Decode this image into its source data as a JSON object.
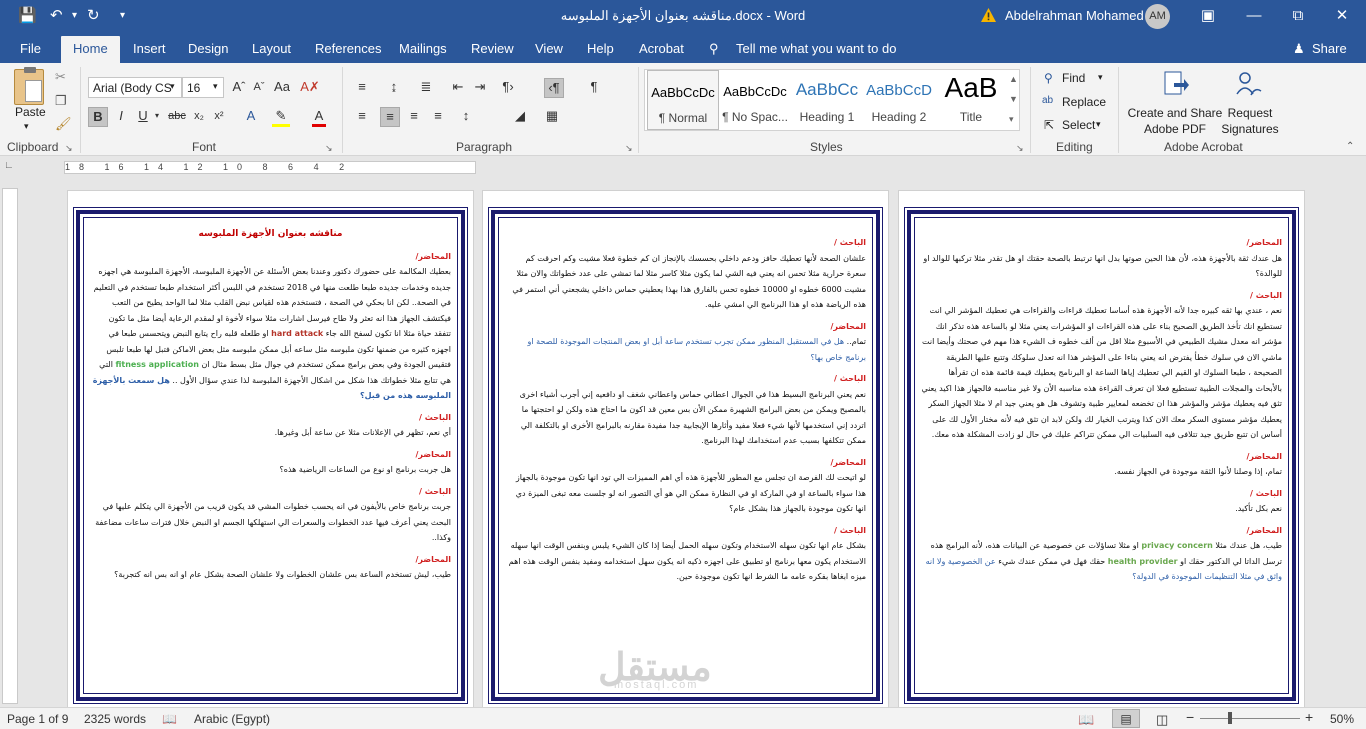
{
  "titlebar": {
    "doc_title": "مناقشه بعنوان الأجهزة الملبوسه.docx",
    "app_suffix": " - Word",
    "user_name": "Abdelrahman Mohamed",
    "user_initials": "AM"
  },
  "tabs": [
    "File",
    "Home",
    "Insert",
    "Design",
    "Layout",
    "References",
    "Mailings",
    "Review",
    "View",
    "Help",
    "Acrobat"
  ],
  "tell_me": "Tell me what you want to do",
  "share": "Share",
  "clipboard": {
    "paste": "Paste",
    "group": "Clipboard"
  },
  "font": {
    "name": "Arial (Body CS",
    "size": "16",
    "group": "Font"
  },
  "paragraph": {
    "group": "Paragraph"
  },
  "styles": {
    "group": "Styles",
    "items": [
      {
        "preview": "AaBbCcDc",
        "name": "¶ Normal"
      },
      {
        "preview": "AaBbCcDc",
        "name": "¶ No Spac..."
      },
      {
        "preview": "AaBbCc",
        "name": "Heading 1"
      },
      {
        "preview": "AaBbCcD",
        "name": "Heading 2"
      },
      {
        "preview": "AaB",
        "name": "Title"
      }
    ]
  },
  "editing": {
    "find": "Find",
    "replace": "Replace",
    "select": "Select",
    "group": "Editing"
  },
  "acrobat": {
    "create": "Create and Share Adobe PDF",
    "request": "Request Signatures",
    "group": "Adobe Acrobat"
  },
  "ruler": {
    "ticks": "18 16 14 12 10 8 6 4 2"
  },
  "pages": {
    "p1": {
      "title": "مناقشه بعنوان الأجهزة الملبوسه",
      "s1": "المحاضر/",
      "t1": "بعطيك المكالمة على حضورك دكتور وعندنا بعض الأسئلة عن الأجهزة الملبوسة، الأجهزة الملبوسة هي اجهزه جديده وخدمات جديده طبعا طلعت منها في 2018 تستخدم في اللبس أكثر استخدام طبعا تستخدم في التعليم في الصحة.. لكن انا بحكي في الصحة ، فتستخدم هذه لقياس نبض القلب مثلا لما الواحد يطيح من التعب فيكتشف الجهاز هذا انه تعثر ولا طاح فيرسل اشارات مثلا سواء لأخوة او لمقدم الرعاية أيضا مثل ما تكون تتفقد حياة مثلا انا تكون لسفح الله جاء",
      "hard_attack": "hard attack",
      "t1b": "او طلعله قلبه راح يتابع النبض ويتحسس طبعا في اجهزه كثيره من ضمنها تكون ملبوسه مثل ساعه أبل ممكن ملبوسه مثل بعض الاماكن فتبل لها طبعا تلبس فتقيس الجودة وفي بعض برامج ممكن تستخدم في جوال مثل بسط مثال ان",
      "fitness": "fitness application",
      "t1c": "التي هي تتابع مثلا خطواتك هذا شكل من اشكال الأجهزة الملبوسة لذا عندي سؤال الأول ..",
      "q1": "هل سمعت بالأجهزة الملبوسه هذه من قبل؟",
      "s2": "الباحث /",
      "t2": "أي نعم، تظهر في الإعلانات مثلا عن ساعة أبل وغيرها.",
      "s3": "المحاضر/",
      "t3": "هل جربت برنامج او نوع من الساعات الرياضية هذه؟",
      "s4": "الباحث /",
      "t4": "جربت برنامج خاص بالأيفون في انه يحسب خطوات المشي قد يكون قريب من الأجهزة الي يتكلم عليها في البحث يعني أعرف فيها عدد الخطوات والسعرات الي استهلكها الجسم او النبض خلال فترات ساعات مضاعفة وكذا..",
      "s5": "المحاضر/",
      "t5": "طيب، ليش تستخدم الساعة بس علشان الخطوات ولا علشان الصحة بشكل عام او انه بس انه كتجربة؟"
    },
    "p2": {
      "s1": "الباحث /",
      "t1": "علشان الصحة لأنها تعطيك حافز ودعم داخلي بحسسك بالإنجاز ان كم خطوة فعلا مشيت وكم احرقت كم سعرة حرارية مثلا تحس انه يعني فيه الشي لما يكون مثلا كاسر مثلا لما تمشي على عدد خطواتك والان مثلا مشيت 6000 خطوه او 10000 خطوه تحس بالفارق هذا بهذا يعطيني حماس داخلي يشجعني أني استمر في هذه الرياضة هذه او هذا البرنامج الي امشي عليه.",
      "s2": "المحاضر/",
      "t2a": "تمام.. ",
      "q2": "هل في المستقبل المنظور ممكن تجرب تستخدم ساعة أبل او بعض المنتجات الموجودة للصحة او برنامج خاص بها؟",
      "s3": "الباحث /",
      "t3": "نعم يعني البرنامج البسيط هذا في الجوال اعطاني حماس واعطاني شغف او دافعيه إني أجرب أشياء اخرى بالمصيح ويمكن من بعض البرامج الشهيرة ممكن الأن بس معين قد اكون ما احتاج هذه ولكن لو احتجتها ما اتردد إني استخدمها لأنها شيء فعلا مفيد وأثارها الإيجابية جدا مفيدة مقارنه بالبرامج الأخرى او بالتكلفة الي ممكن تتكلفها بسبب عدم استخدامك لهذا البرنامج.",
      "s4": "المحاضر/",
      "t4": "لو اتيحت لك الفرصة ان تجلس مع المطور للأجهزة هذه أي اهم المميزات الي تود انها تكون موجودة بالجهاز هذا سواء بالساعة او في الماركة او في النظارة ممكن الي هو أي التصور انه لو جلست معه تبغى الميزة دي انها تكون موجودة بالجهاز هذا بشكل عام؟",
      "s5": "الباحث /",
      "t5": "بشكل عام انها تكون سهله الاستخدام وتكون سهله الحمل أيضا إذا كان الشيء يلبس وبنفس الوقت انها سهله الاستخدام يكون معها برنامج او تطبيق على اجهزه ذكيه انه يكون سهل استخدامه ومفيد بنفس الوقت هذه اهم ميزه ابغاها بفكره عامه ما الشرط انها تكون موجودة حين."
    },
    "p3": {
      "s1": "المحاضر/",
      "t1": "هل عندك ثقة بالأجهزة هذه، لأن هذا الحين صوتها بدل انها ترتبط بالصحة حقتك او هل تقدر مثلا تركبها للوالد او للوالدة؟",
      "s2": "الباحث /",
      "t2": "نعم ، عندي بها ثقه كبيره جدا لأنه الأجهزة هذه أساسا تعطيك قراءات والقراءات هي تعطيك المؤشر الي انت تستطيع انك تأخذ الطريق الصحيح بناء على هذه القراءات او المؤشرات يعني مثلا لو بالساعة هذه تذكر انك مؤشر انه معدل مشيك الطبيعي في الأسبوع مثلا اقل من ألف خطوه ف الشيء هذا مهم في صحتك وأيضا انت ماشي الان في سلوك خطأ يفترض انه يعني بناءا على المؤشر هذا انه تعدل سلوكك وتتبع عليها الطريقة الصحيحة ، طبعا السلوك او القيم الي تعطيك إياها الساعة او البرنامج يعطيك قيمة قائمة هذه ان تقرأها بالأبحاث والمجلات الطبية تستطيع فعلا ان تعرف القراءة هذه مناسبه الأن ولا غير مناسبه فالجهاز هذا اكيد يعني تثق فيه يعطيك مؤشر والمؤشر هذا ان تخضعه لمعايير طبية وتشوف هل هو يعني جيد ام لا مثلا الجهاز السكر يعطيك مؤشر مستوى السكر معك الان كذا ويترتب الخيار لك ولكن لابد ان تثق فيه لأنه مختار الأول لك على أساس ان تتبع طريق جيد تتلافى فيه السلبيات الي ممكن تتراكم عليك في حال لو زادت المشكلة هذه معك.",
      "s3": "المحاضر/",
      "t3": "تمام، إذا وصلنا لأنوا الثقة موجودة في الجهاز نفسه.",
      "s4": "الباحث /",
      "t4": "نعم بكل تأكيد.",
      "s5": "المحاضر/",
      "t5a": "طيب، هل عندك مثلا",
      "privacy": "privacy concern",
      "t5b": "او مثلا تساؤلات عن خصوصية عن البيانات هذه، لأنه البرامج هذه ترسل الداتا لي الدكتور حقك او",
      "health": "health provider",
      "t5c": "حقك فهل في ممكن عندك شيء",
      "q5": "عن الخصوصية ولا انه واثق في مثلا التنظيمات الموجودة في الدولة؟"
    }
  },
  "status": {
    "page": "Page 1 of 9",
    "words": "2325 words",
    "language": "Arabic (Egypt)",
    "zoom": "50%"
  },
  "watermark": {
    "main": "مستقل",
    "sub": "mostaql.com"
  },
  "colors": {
    "accent": "#2b579a",
    "border": "#1a1a6e",
    "speaker": "#d02020",
    "highlight": "#4caf50",
    "question": "#2e5fa8"
  }
}
